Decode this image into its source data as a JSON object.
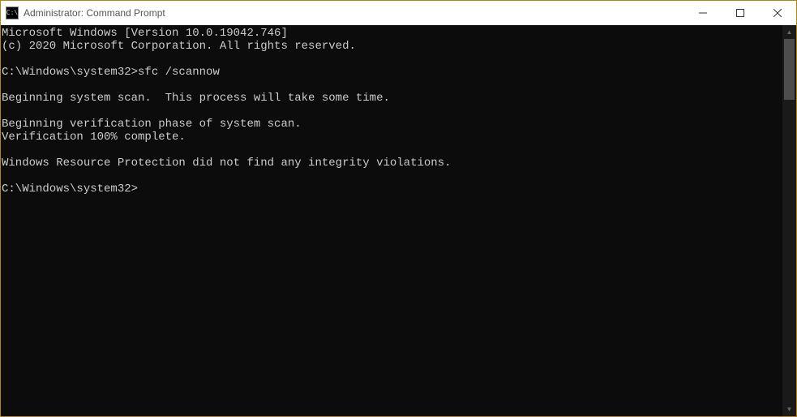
{
  "titlebar": {
    "icon_text": "C:\\",
    "title": "Administrator: Command Prompt"
  },
  "console": {
    "lines": [
      "Microsoft Windows [Version 10.0.19042.746]",
      "(c) 2020 Microsoft Corporation. All rights reserved.",
      "",
      "C:\\Windows\\system32>sfc /scannow",
      "",
      "Beginning system scan.  This process will take some time.",
      "",
      "Beginning verification phase of system scan.",
      "Verification 100% complete.",
      "",
      "Windows Resource Protection did not find any integrity violations.",
      "",
      "C:\\Windows\\system32>"
    ]
  }
}
